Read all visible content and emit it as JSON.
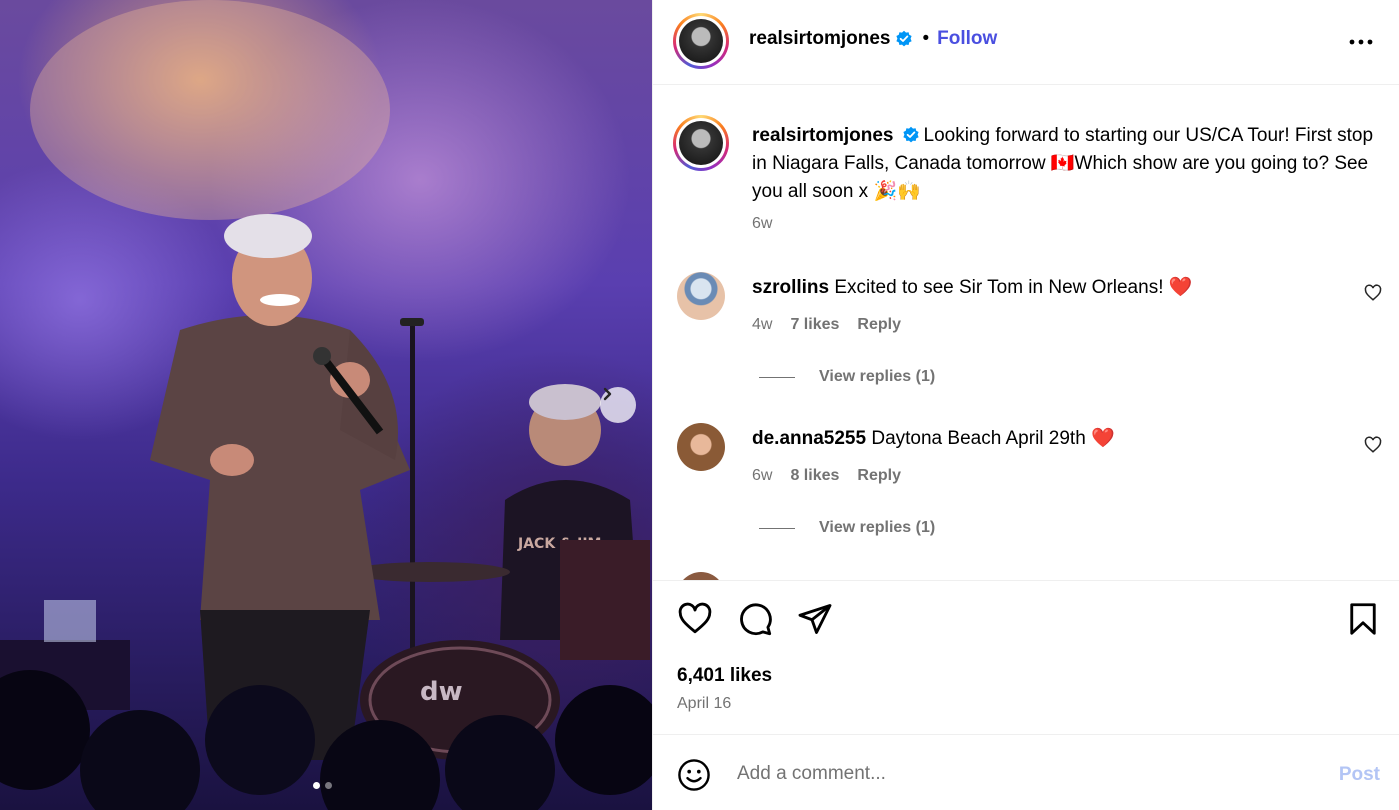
{
  "post": {
    "username": "realsirtomjones",
    "verified": true,
    "follow_label": "Follow",
    "bullet": "•",
    "caption": "Looking forward to starting our US/CA Tour! First stop in Niagara Falls, Canada tomorrow 🇨🇦Which show are you going to? See you all soon x 🎉🙌",
    "caption_time": "6w",
    "likes": "6,401 likes",
    "date": "April 16",
    "carousel_index": 1,
    "carousel_count": 2
  },
  "comments": [
    {
      "username": "szrollins",
      "text": "Excited to see Sir Tom in New Orleans! ❤️",
      "time": "4w",
      "likes": "7 likes",
      "reply_label": "Reply",
      "view_replies": "View replies (1)"
    },
    {
      "username": "de.anna5255",
      "text": "Daytona Beach April 29th ❤️",
      "time": "6w",
      "likes": "8 likes",
      "reply_label": "Reply",
      "view_replies": "View replies (1)"
    }
  ],
  "composer": {
    "placeholder": "Add a comment...",
    "post_label": "Post"
  },
  "colors": {
    "follow": "#4a4fe0",
    "verified": "#0095f6",
    "post_disabled": "#b3c5f5",
    "muted": "#737373"
  },
  "icons": [
    "more-icon",
    "verified-icon",
    "heart-icon",
    "comment-icon",
    "share-icon",
    "bookmark-icon",
    "emoji-icon",
    "chevron-right-icon"
  ]
}
